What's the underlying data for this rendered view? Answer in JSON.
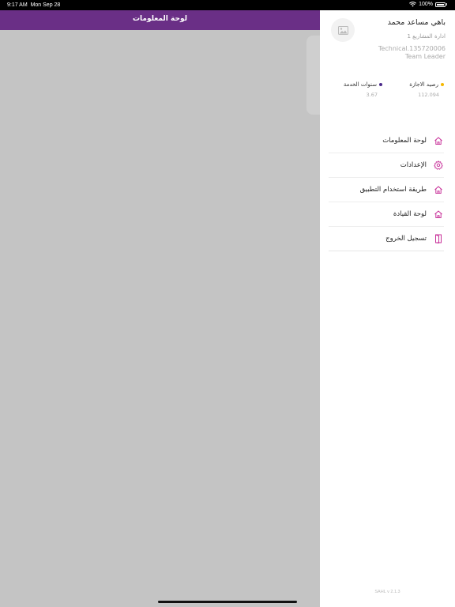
{
  "status_bar": {
    "time": "9:17 AM",
    "date": "Mon Sep 28",
    "battery": "100%"
  },
  "header": {
    "title": "لوحة المعلومات"
  },
  "profile": {
    "name": "باهي مساعد محمد",
    "department": "ادارة المشاريع 1",
    "job_code": "Technical.135720006",
    "job_title": "Team Leader"
  },
  "stats": {
    "leave_balance": {
      "label": "رصيد الاجازة",
      "value": "112.094",
      "color": "#f5b800"
    },
    "service_years": {
      "label": "سنوات الخدمة",
      "value": "3.67",
      "color": "#4b2a8a"
    }
  },
  "menu": {
    "items": [
      {
        "label": "لوحة المعلومات",
        "icon": "home-icon"
      },
      {
        "label": "الإعدادات",
        "icon": "gear-icon"
      },
      {
        "label": "طريقة استخدام التطبيق",
        "icon": "home-icon"
      },
      {
        "label": "لوحة القيادة",
        "icon": "home-icon"
      },
      {
        "label": "تسجيل الخروج",
        "icon": "logout-door-icon"
      }
    ]
  },
  "footer": {
    "version": "SAHL v 2.1.3"
  },
  "colors": {
    "accent": "#c8329a",
    "navbar": "#6a2f86"
  }
}
